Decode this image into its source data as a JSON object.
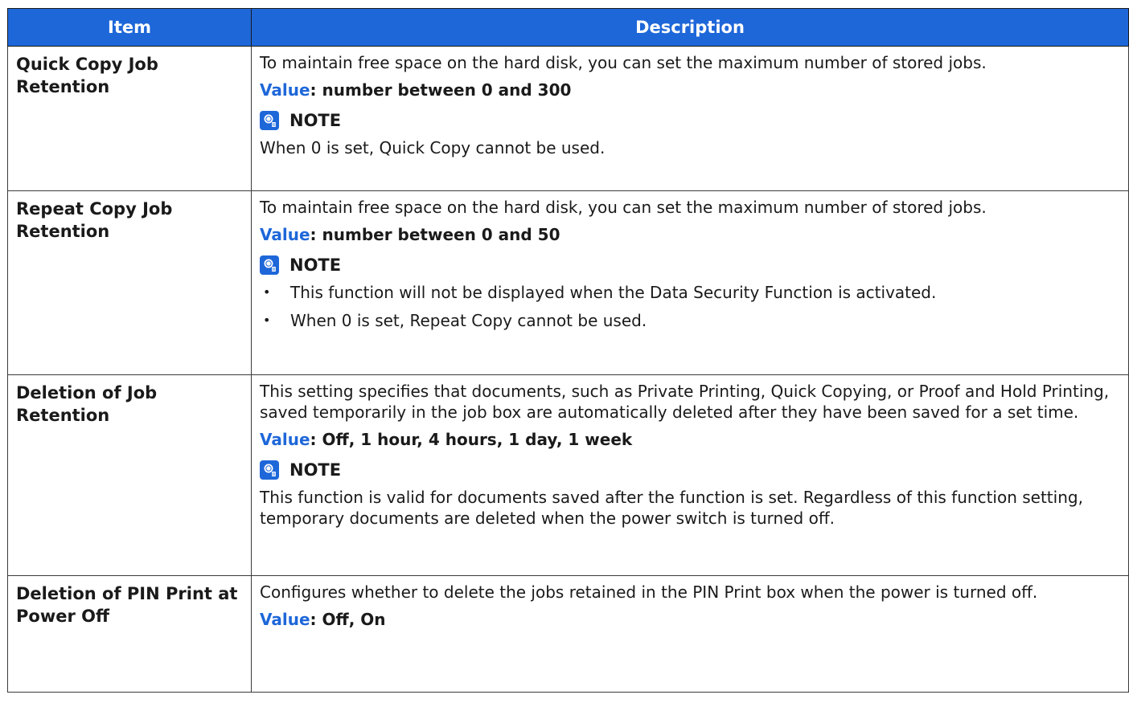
{
  "header": {
    "item": "Item",
    "description": "Description"
  },
  "colors": {
    "accent": "#1e67d9",
    "border": "#3a3a3a"
  },
  "rows": [
    {
      "item": "Quick Copy Job Retention",
      "text": "To maintain free space on the hard disk, you can set the maximum number of stored jobs.",
      "value_key": "Value",
      "value_rest": ": number between 0 and 300",
      "note_label": "NOTE",
      "note_text": "When 0 is set, Quick Copy cannot be used."
    },
    {
      "item": "Repeat Copy Job Retention",
      "text": "To maintain free space on the hard disk, you can set the maximum number of stored jobs.",
      "value_key": "Value",
      "value_rest": ": number between 0 and 50",
      "note_label": "NOTE",
      "note_bullets": [
        "This function will not be displayed when the Data Security Function is activated.",
        "When 0 is set, Repeat Copy cannot be used."
      ]
    },
    {
      "item": "Deletion of Job Retention",
      "text": "This setting specifies that documents, such as Private Printing, Quick Copying, or Proof and Hold Printing, saved temporarily in the job box are automatically deleted after they have been saved for a set time.",
      "value_key": "Value",
      "value_rest": ": Off, 1 hour, 4 hours, 1 day, 1 week",
      "note_label": "NOTE",
      "note_text": "This function is valid for documents saved after the function is set. Regardless of this function setting, temporary documents are deleted when the power switch is turned off."
    },
    {
      "item": "Deletion of PIN Print at Power Off",
      "text": "Configures whether to delete the jobs retained in the PIN Print box when the power is turned off.",
      "value_key": "Value",
      "value_rest": ": Off, On"
    }
  ],
  "icons": {
    "note": "note-lightbulb-icon"
  }
}
